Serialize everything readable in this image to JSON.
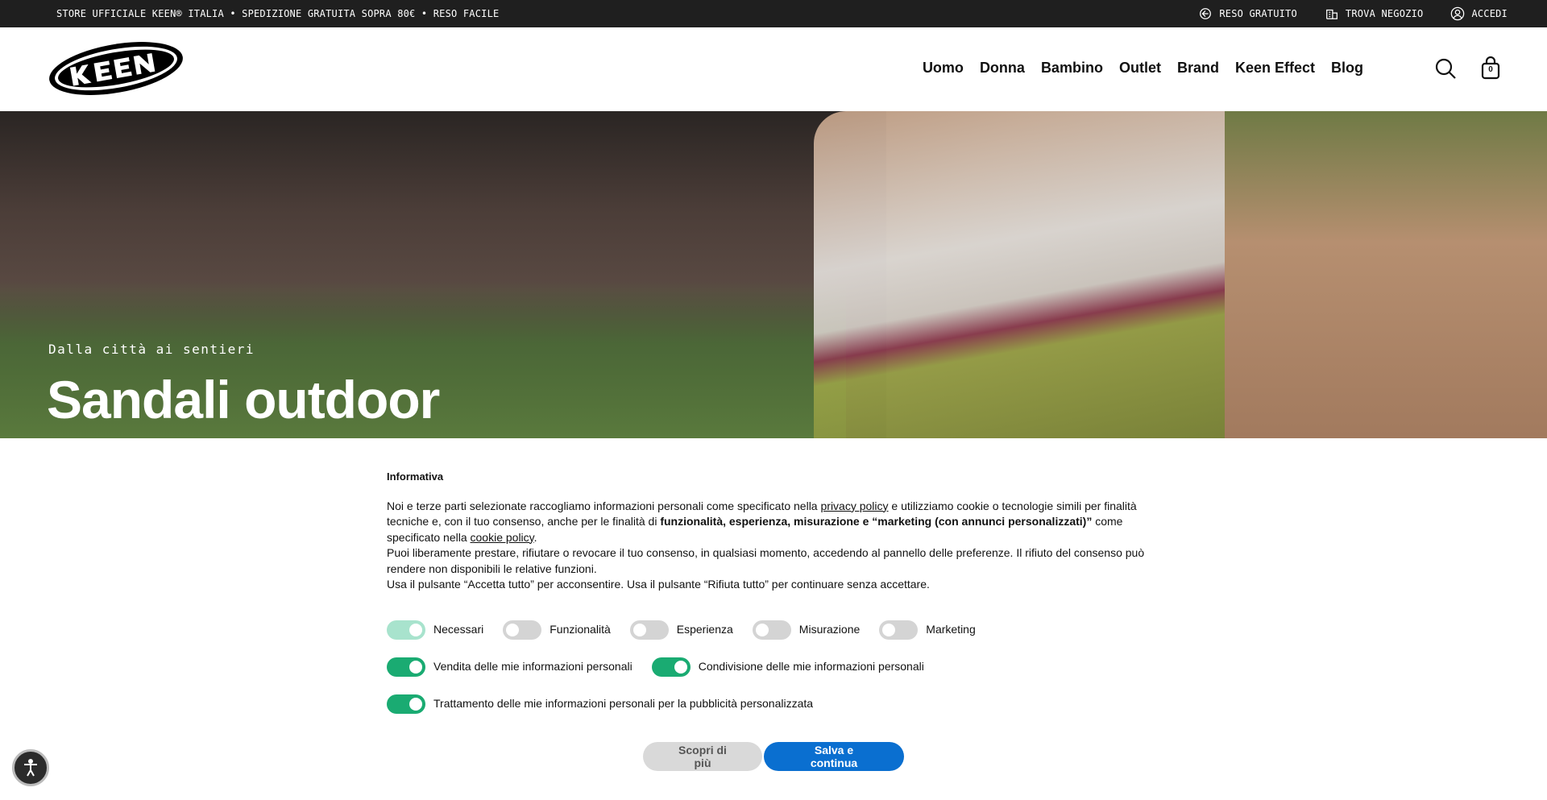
{
  "topbar": {
    "promo": "STORE UFFICIALE KEEN® ITALIA • SPEDIZIONE GRATUITA SOPRA 80€ • RESO FACILE",
    "links": [
      {
        "label": "RESO GRATUITO",
        "icon": "return-icon"
      },
      {
        "label": "TROVA NEGOZIO",
        "icon": "store-icon"
      },
      {
        "label": "ACCEDI",
        "icon": "user-icon"
      }
    ]
  },
  "header": {
    "logo": "KEEN",
    "nav": [
      "Uomo",
      "Donna",
      "Bambino",
      "Outlet",
      "Brand",
      "Keen Effect",
      "Blog"
    ],
    "cart_count": "0"
  },
  "hero": {
    "kicker": "Dalla città ai sentieri",
    "title": "Sandali outdoor"
  },
  "consent": {
    "title": "Informativa",
    "p1_a": "Noi e terze parti selezionate raccogliamo informazioni personali come specificato nella ",
    "p1_link": "privacy policy",
    "p1_b": " e utilizziamo cookie o tecnologie simili per finalità tecniche e, con il tuo consenso, anche per le finalità di ",
    "p1_bold": "funzionalità, esperienza, misurazione e “marketing (con annunci personalizzati)”",
    "p1_c": " come specificato nella ",
    "p1_link2": "cookie policy",
    "p1_d": ".",
    "p2": "Puoi liberamente prestare, rifiutare o revocare il tuo consenso, in qualsiasi momento, accedendo al pannello delle preferenze. Il rifiuto del consenso può rendere non disponibili le relative funzioni.",
    "p3": "Usa il pulsante “Accetta tutto” per acconsentire. Usa il pulsante “Rifiuta tutto” per continuare senza accettare.",
    "toggles": [
      {
        "label": "Necessari",
        "state": "on-disabled"
      },
      {
        "label": "Funzionalità",
        "state": "off"
      },
      {
        "label": "Esperienza",
        "state": "off"
      },
      {
        "label": "Misurazione",
        "state": "off"
      },
      {
        "label": "Marketing",
        "state": "off"
      }
    ],
    "toggles2": [
      {
        "label": "Vendita delle mie informazioni personali",
        "state": "on"
      },
      {
        "label": "Condivisione delle mie informazioni personali",
        "state": "on"
      }
    ],
    "toggles3": [
      {
        "label": "Trattamento delle mie informazioni personali per la pubblicità personalizzata",
        "state": "on"
      }
    ],
    "btn_more": "Scopri di più",
    "btn_save": "Salva e continua"
  }
}
